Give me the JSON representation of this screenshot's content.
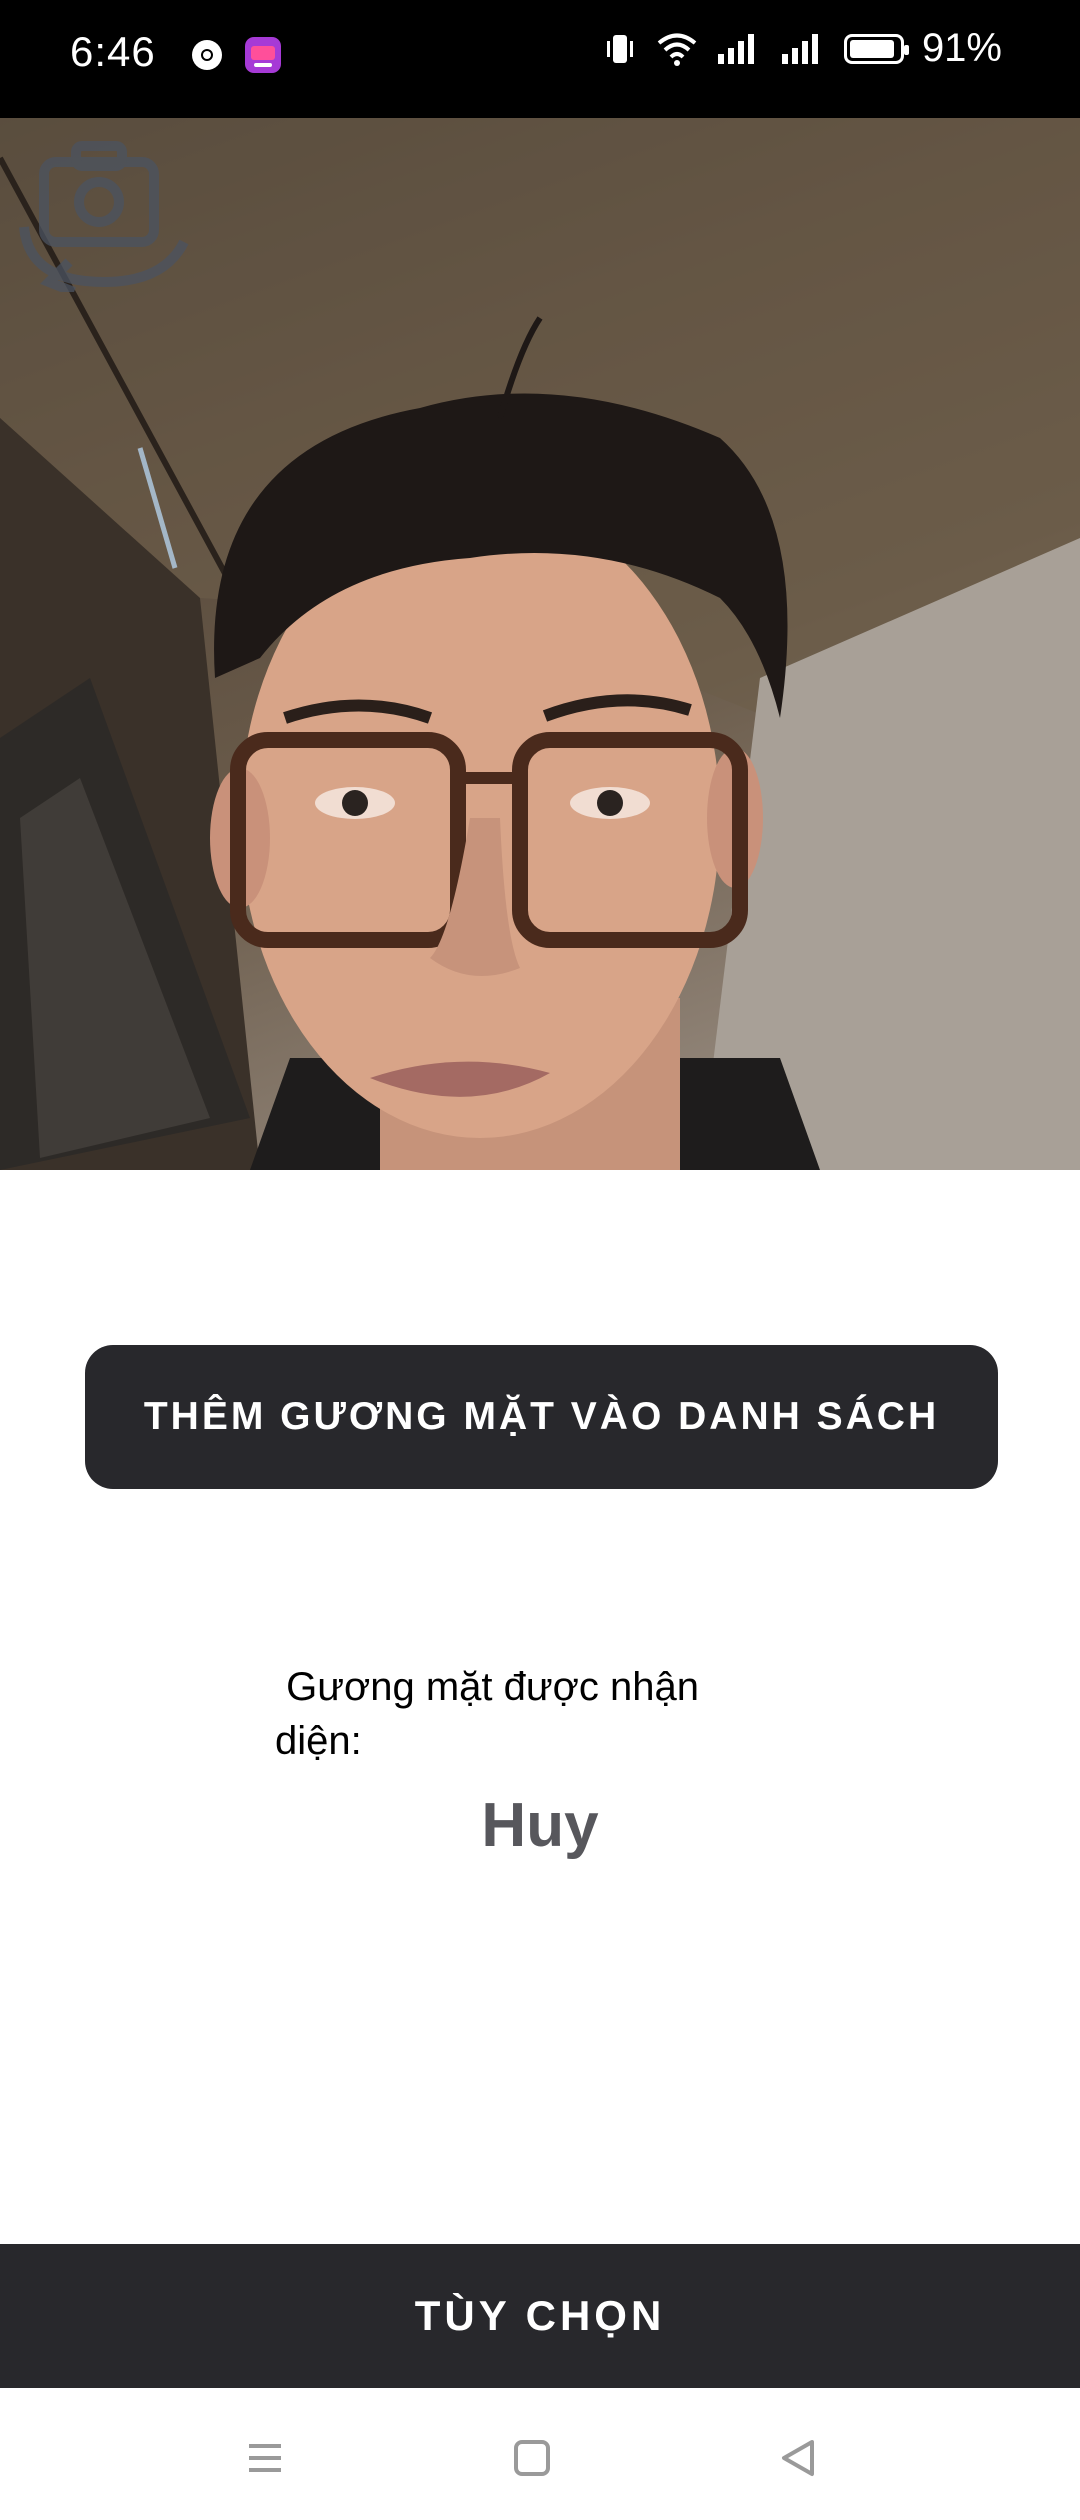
{
  "status_bar": {
    "time": "6:46",
    "battery_percent": "91%",
    "battery_level": 0.91,
    "icons": [
      "chrome-icon",
      "app-notification-icon",
      "vibrate-icon",
      "wifi-icon",
      "signal-icon",
      "signal-icon",
      "battery-icon"
    ]
  },
  "camera": {
    "switch_icon": "switch-camera-icon"
  },
  "actions": {
    "add_face_label": "THÊM GƯƠNG MẶT VÀO DANH SÁCH"
  },
  "recognition": {
    "label_line1": " Gương mặt được nhận",
    "label_line2": "diện:",
    "name": "Huy"
  },
  "bottom_bar": {
    "options_label": "TÙY CHỌN"
  },
  "nav": {
    "icons": [
      "menu-icon",
      "home-icon",
      "back-icon"
    ]
  }
}
